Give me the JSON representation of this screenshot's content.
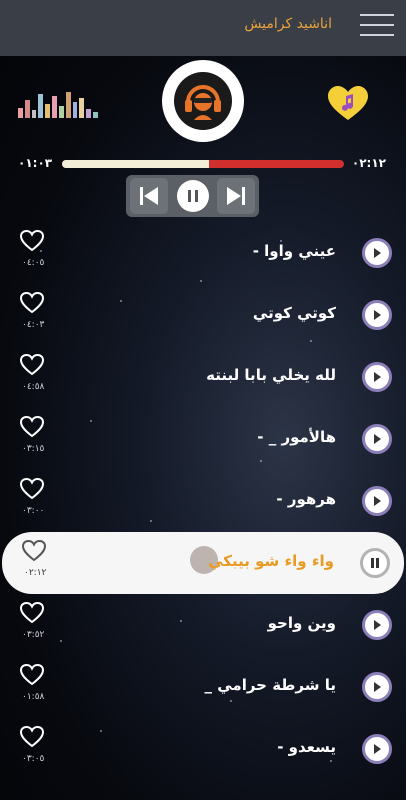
{
  "header": {
    "title": "اناشيد كراميش",
    "menu_icon": "hamburger-icon"
  },
  "player": {
    "elapsed": "٠١:٠٣",
    "duration": "٠٢:١٢",
    "progress": 0.52,
    "logo_icon": "headphones-avatar-icon",
    "equalizer_icon": "equalizer-icon",
    "favorites_icon": "heart-music-icon"
  },
  "colors": {
    "accent": "#e89a22",
    "progress_played": "#f2eed8",
    "progress_remaining": "#d12e2e",
    "topbar": "#3a3f47"
  },
  "tracks": [
    {
      "title": "عيني واوا -",
      "duration": "٠٤:٠٥",
      "active": false
    },
    {
      "title": "كوتي كوتي",
      "duration": "٠٤:٠٣",
      "active": false
    },
    {
      "title": "لله يخلي بابا لبنته",
      "duration": "٠٤:٥٨",
      "active": false
    },
    {
      "title": "هالأمور _ -",
      "duration": "٠٣:١٥",
      "active": false
    },
    {
      "title": "هرهور -",
      "duration": "٠٣:٠٠",
      "active": false
    },
    {
      "title": "واء واء شو بيبكي",
      "duration": "٠٢:١٢",
      "active": true
    },
    {
      "title": "وين واحو",
      "duration": "٠٣:٥٢",
      "active": false
    },
    {
      "title": "يا شرطة حرامي _",
      "duration": "٠١:٥٨",
      "active": false
    },
    {
      "title": "يسعدو -",
      "duration": "٠٣:٠٥",
      "active": false
    }
  ]
}
